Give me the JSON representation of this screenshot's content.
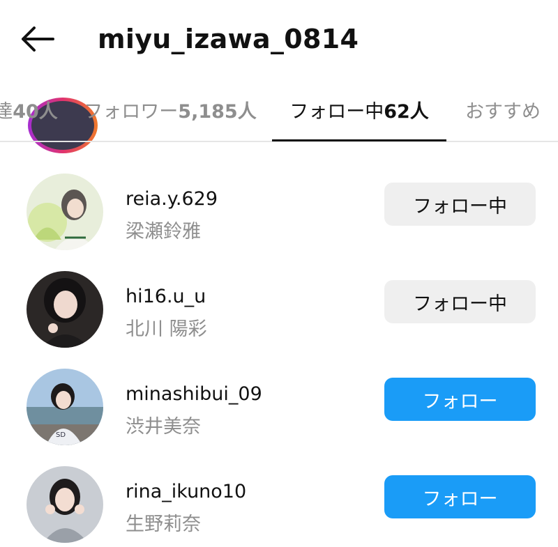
{
  "header": {
    "back_icon": "arrow-left-icon",
    "username": "miyu_izawa_0814"
  },
  "tabs": [
    {
      "label": "達",
      "count": "40人"
    },
    {
      "label": "フォロワー",
      "count": "5,185人"
    },
    {
      "label": "フォロー中",
      "count": "62人",
      "active": true
    },
    {
      "label": "おすすめ",
      "count": ""
    }
  ],
  "list": [
    {
      "username": "reia.y.629",
      "full_name": "梁瀬鈴雅",
      "button": "フォロー中",
      "following": true
    },
    {
      "username": "hi16.u_u",
      "full_name": "北川 陽彩",
      "button": "フォロー中",
      "following": true
    },
    {
      "username": "minashibui_09",
      "full_name": "渋井美奈",
      "button": "フォロー",
      "following": false
    },
    {
      "username": "rina_ikuno10",
      "full_name": "生野莉奈",
      "button": "フォロー",
      "following": false
    }
  ],
  "colors": {
    "follow_button": "#1a9cf7",
    "following_button": "#efefef",
    "secondary_text": "#8e8e8e"
  }
}
